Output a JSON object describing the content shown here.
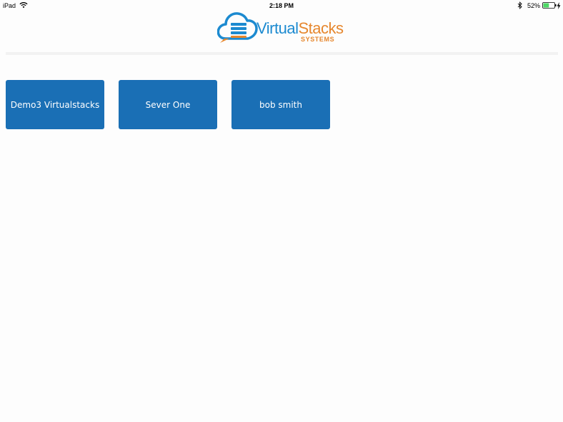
{
  "status_bar": {
    "device": "iPad",
    "time": "2:18 PM",
    "battery": "52%",
    "battery_level": 0.52,
    "wifi_icon": "wifi-icon",
    "bluetooth_icon": "bluetooth-icon",
    "charging_icon": "charging-bolt-icon"
  },
  "header": {
    "logo_icon": "cloud-server-icon",
    "brand_part1": "Virtual",
    "brand_part2": "Stacks",
    "brand_sub": "SYSTEMS",
    "colors": {
      "primary": "#1c8ad0",
      "secondary": "#e6872e"
    }
  },
  "tiles": [
    {
      "label": "Demo3 Virtualstacks"
    },
    {
      "label": "Sever One"
    },
    {
      "label": "bob smith"
    }
  ],
  "colors": {
    "tile_bg": "#1a6fb5",
    "tile_text": "#ffffff",
    "page_bg": "#fdfdfd"
  }
}
